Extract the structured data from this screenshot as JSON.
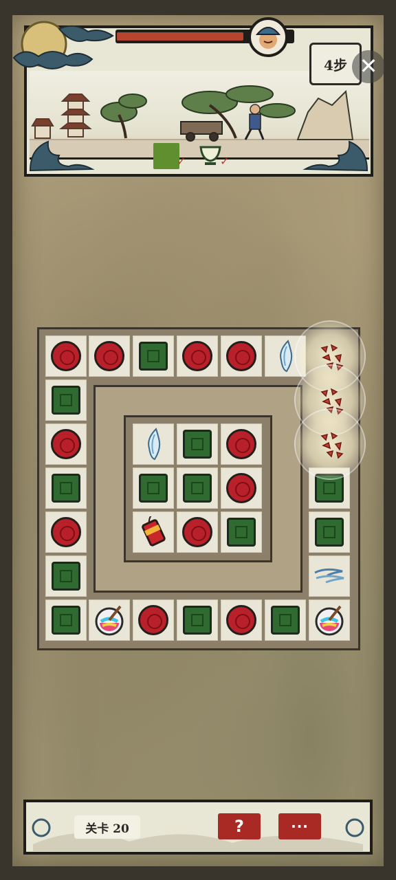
{
  "header": {
    "steps_label": "4步",
    "health_fraction": 0.72,
    "goals": [
      {
        "icon": "green-tile-icon",
        "done": true,
        "check": "✓"
      },
      {
        "icon": "cup-icon",
        "done": true,
        "check": "✓"
      }
    ],
    "close_label": "✕"
  },
  "footer": {
    "level_label": "关卡 20",
    "help_label": "?",
    "more_label": "···"
  },
  "colors": {
    "piece_red": "#b8212a",
    "piece_green": "#2f6b31",
    "button_red": "#a92a25",
    "health_red": "#b5452e"
  }
}
